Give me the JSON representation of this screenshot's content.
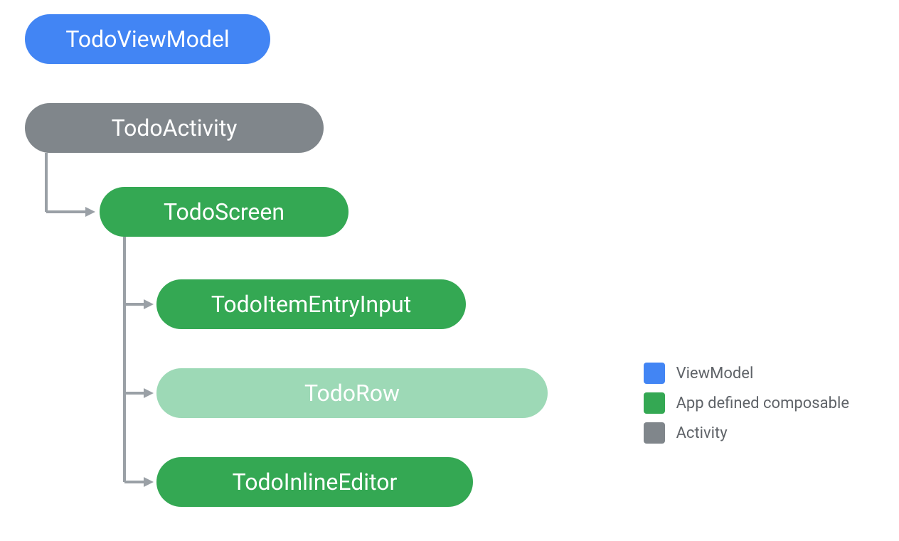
{
  "nodes": {
    "todoViewModel": {
      "label": "TodoViewModel"
    },
    "todoActivity": {
      "label": "TodoActivity"
    },
    "todoScreen": {
      "label": "TodoScreen"
    },
    "todoItemEntryInput": {
      "label": "TodoItemEntryInput"
    },
    "todoRow": {
      "label": "TodoRow"
    },
    "todoInlineEditor": {
      "label": "TodoInlineEditor"
    }
  },
  "legend": {
    "viewModel": {
      "label": "ViewModel"
    },
    "composable": {
      "label": "App defined composable"
    },
    "activity": {
      "label": "Activity"
    }
  },
  "colors": {
    "blue": "#4285f4",
    "green": "#34a853",
    "lightGreen": "#9dd9b6",
    "grey": "#80868b",
    "arrowGrey": "#9aa0a6",
    "textGrey": "#5f6368"
  }
}
